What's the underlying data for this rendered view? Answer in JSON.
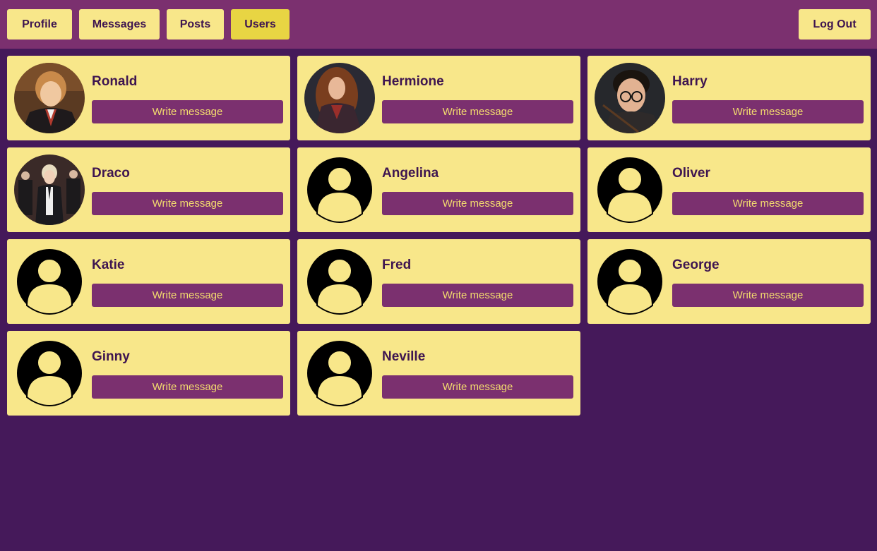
{
  "nav": {
    "tabs": [
      {
        "label": "Profile",
        "active": false
      },
      {
        "label": "Messages",
        "active": false
      },
      {
        "label": "Posts",
        "active": false
      },
      {
        "label": "Users",
        "active": true
      }
    ],
    "logout_label": "Log Out"
  },
  "users": [
    {
      "name": "Ronald",
      "avatar": "photo-ronald",
      "action_label": "Write message"
    },
    {
      "name": "Hermione",
      "avatar": "photo-hermione",
      "action_label": "Write message"
    },
    {
      "name": "Harry",
      "avatar": "photo-harry",
      "action_label": "Write message"
    },
    {
      "name": "Draco",
      "avatar": "photo-draco",
      "action_label": "Write message"
    },
    {
      "name": "Angelina",
      "avatar": "default-user-icon",
      "action_label": "Write message"
    },
    {
      "name": "Oliver",
      "avatar": "default-user-icon",
      "action_label": "Write message"
    },
    {
      "name": "Katie",
      "avatar": "default-user-icon",
      "action_label": "Write message"
    },
    {
      "name": "Fred",
      "avatar": "default-user-icon",
      "action_label": "Write message"
    },
    {
      "name": "George",
      "avatar": "default-user-icon",
      "action_label": "Write message"
    },
    {
      "name": "Ginny",
      "avatar": "default-user-icon",
      "action_label": "Write message"
    },
    {
      "name": "Neville",
      "avatar": "default-user-icon",
      "action_label": "Write message"
    }
  ],
  "colors": {
    "page_bg": "#45195a",
    "topbar_bg": "#7b306f",
    "card_bg": "#f8e78a",
    "active_tab_bg": "#e8d543",
    "button_bg": "#7b306f",
    "button_text": "#f3dc6e",
    "name_text": "#3e1550"
  }
}
